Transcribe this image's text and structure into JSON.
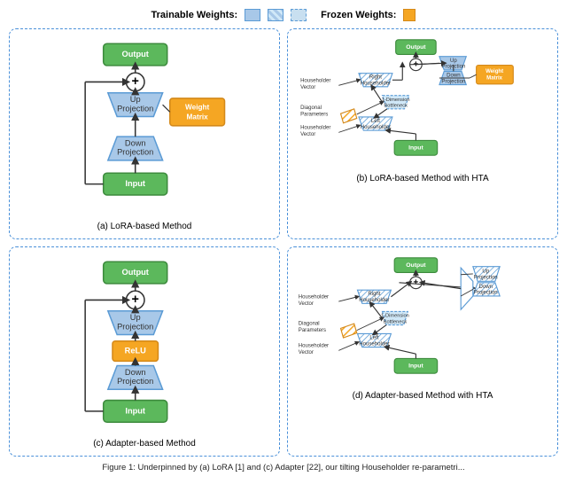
{
  "legend": {
    "trainable_label": "Trainable Weights:",
    "frozen_label": "Frozen Weights:"
  },
  "diagrams": [
    {
      "id": "a",
      "label": "(a) LoRA-based Method"
    },
    {
      "id": "b",
      "label": "(b) LoRA-based Method with HTA"
    },
    {
      "id": "c",
      "label": "(c) Adapter-based Method"
    },
    {
      "id": "d",
      "label": "(d) Adapter-based Method with HTA"
    }
  ],
  "caption": "Figure 1: Underpinned by (a) LoRA [1] and (c) Adapter [22], our tilting Householder re-parametri..."
}
